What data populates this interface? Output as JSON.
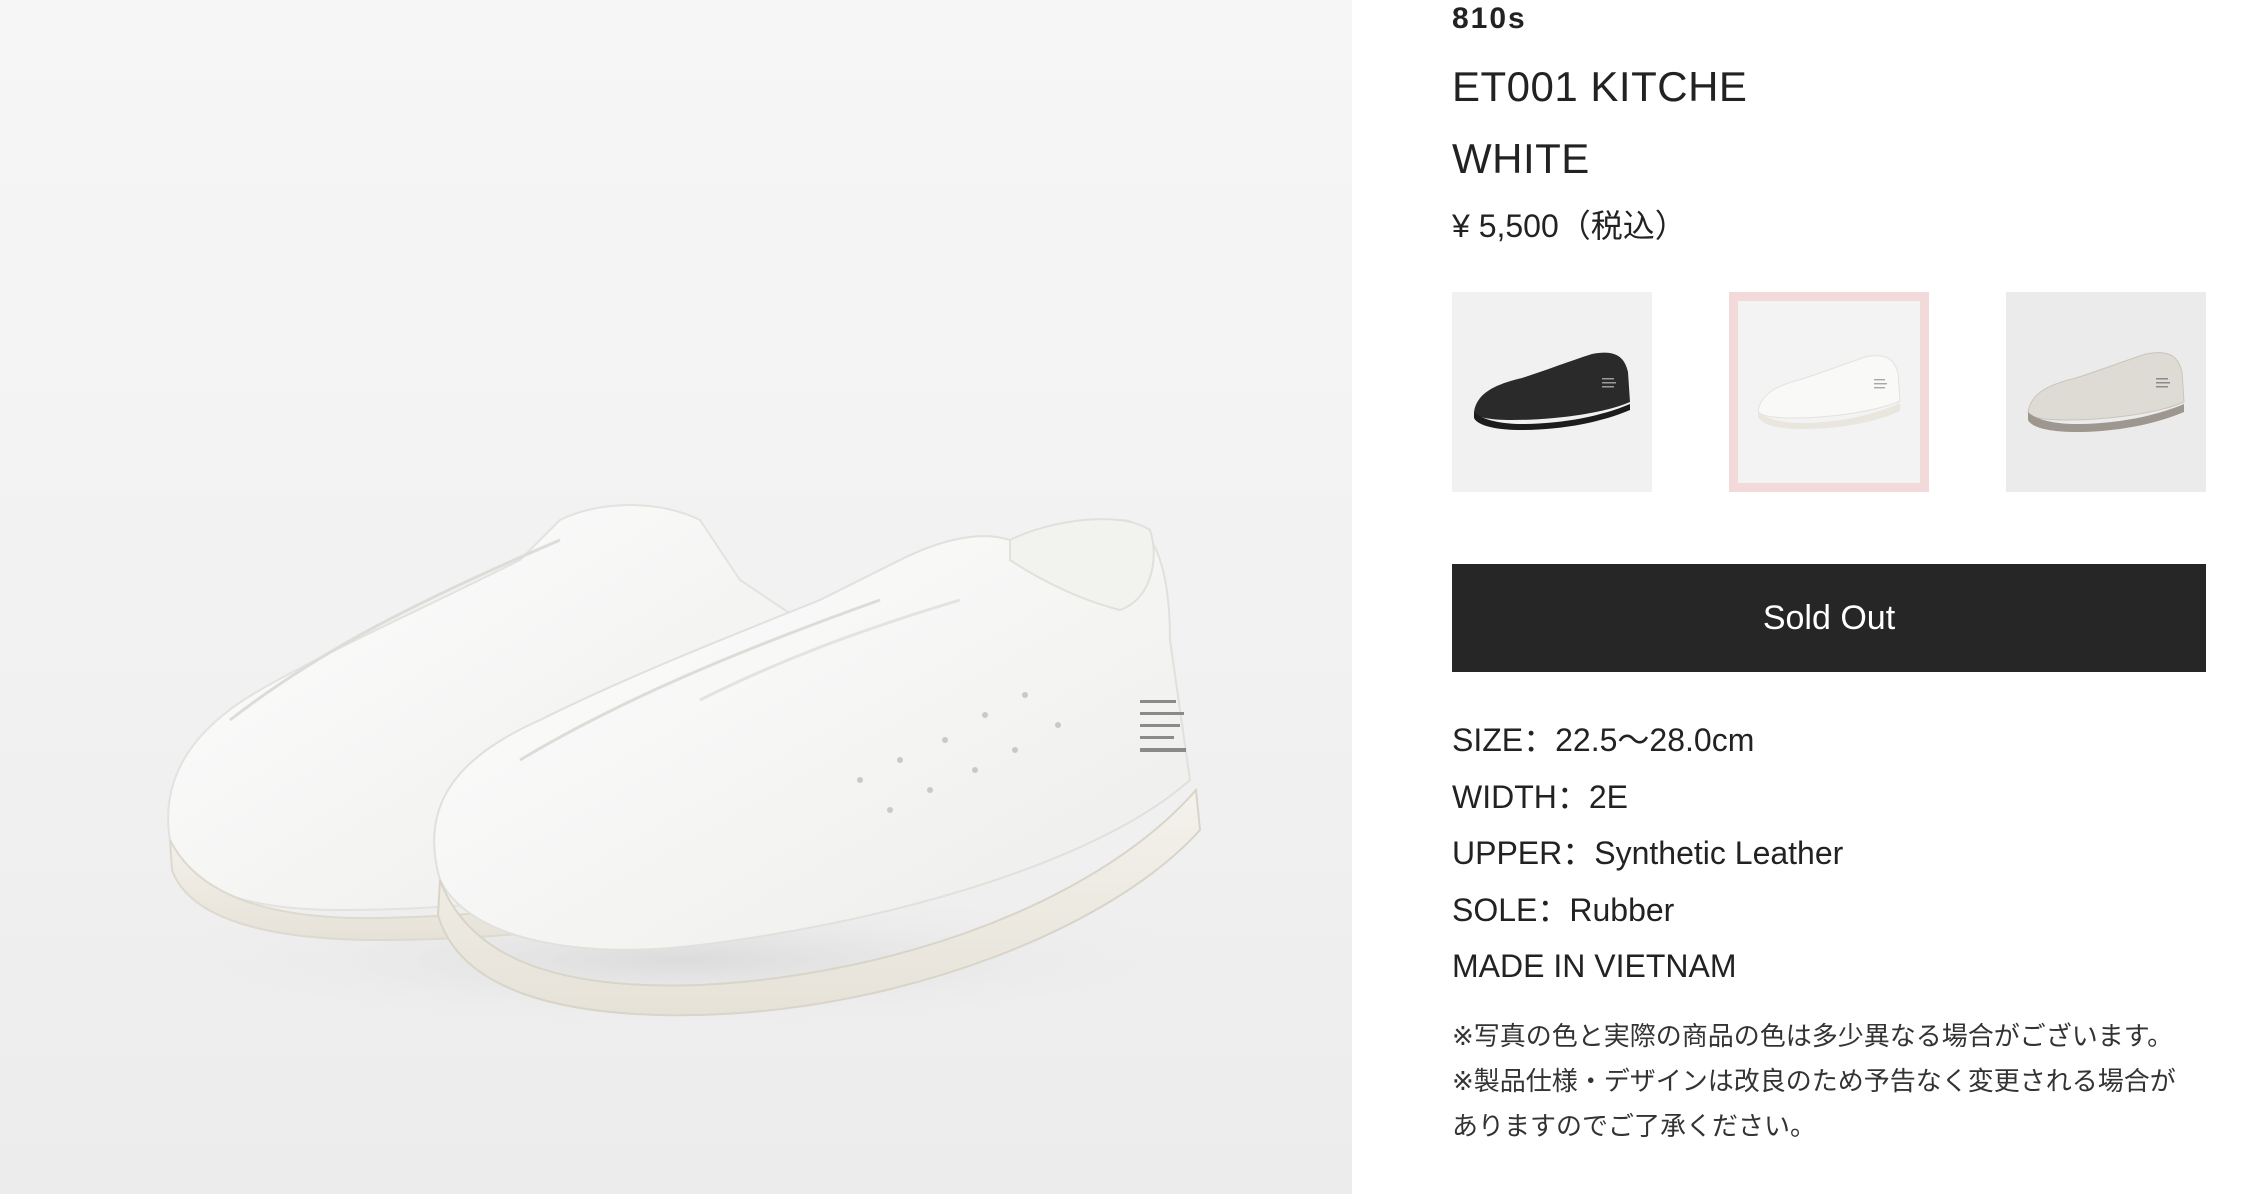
{
  "product": {
    "brand": "810s",
    "name": "ET001 KITCHE",
    "color_name": "WHITE",
    "price": "¥ 5,500（税込）"
  },
  "hero_image": {
    "icon": "white-slip-on-sneaker-photo"
  },
  "color_swatches": [
    {
      "icon": "black-sneaker-thumbnail",
      "selected": false,
      "shoe_color": "#2a2a2a"
    },
    {
      "icon": "white-sneaker-thumbnail",
      "selected": true,
      "shoe_color": "#f7f7f5"
    },
    {
      "icon": "grey-sneaker-thumbnail",
      "selected": false,
      "shoe_color": "#d9d6d0"
    }
  ],
  "buy_button": {
    "label": "Sold Out",
    "background": "#262626"
  },
  "specs": [
    "SIZE：22.5〜28.0cm",
    "WIDTH：2E",
    "UPPER：Synthetic Leather",
    "SOLE：Rubber",
    "MADE IN VIETNAM"
  ],
  "notes": [
    "※写真の色と実際の商品の色は多少異なる場合がございます。",
    "※製品仕様・デザインは改良のため予告なく変更される場合が",
    "ありますのでご了承ください。"
  ],
  "colors": {
    "selected_swatch_border": "#f2d9da",
    "text": "#222222"
  }
}
